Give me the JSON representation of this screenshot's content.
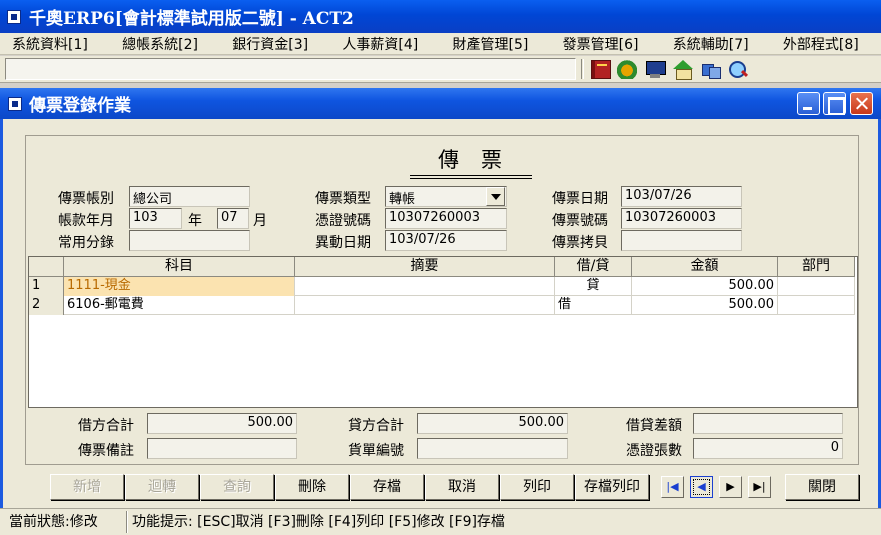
{
  "app": {
    "title": "千奧ERP6[會計標準試用版二號] - ACT2"
  },
  "menu": [
    "系統資料[1]",
    "總帳系統[2]",
    "銀行資金[3]",
    "人事薪資[4]",
    "財產管理[5]",
    "發票管理[6]",
    "系統輔助[7]",
    "外部程式[8]"
  ],
  "toolbar_icons": [
    "book-icon",
    "recycle-icon",
    "monitor-icon",
    "house-icon",
    "cubes-icon",
    "magnifier-icon"
  ],
  "window": {
    "title": "傳票登錄作業"
  },
  "voucher": {
    "heading": "傳票",
    "labels": {
      "account_book": "傳票帳別",
      "ym": "帳款年月",
      "year_unit": "年",
      "month_unit": "月",
      "common_entry": "常用分錄",
      "type": "傳票類型",
      "certificate_no": "憑證號碼",
      "change_date": "異動日期",
      "date": "傳票日期",
      "number": "傳票號碼",
      "copy": "傳票拷貝"
    },
    "values": {
      "account_book": "總公司",
      "year": "103",
      "month": "07",
      "common_entry": "",
      "type": "轉帳",
      "certificate_no": "10307260003",
      "change_date": "103/07/26",
      "date": "103/07/26",
      "number": "10307260003",
      "copy": ""
    }
  },
  "grid": {
    "columns": [
      "科目",
      "摘要",
      "借/貸",
      "金額",
      "部門"
    ],
    "rows": [
      {
        "no": "1",
        "account": "1111-現金",
        "summary": "",
        "dc": "貸",
        "amount": "500.00",
        "dept": ""
      },
      {
        "no": "2",
        "account": "6106-郵電費",
        "summary": "",
        "dc": "借",
        "amount": "500.00",
        "dept": ""
      }
    ]
  },
  "totals": {
    "labels": {
      "debit_total": "借方合計",
      "credit_total": "貸方合計",
      "difference": "借貸差額",
      "remark": "傳票備註",
      "bill_no": "貨單編號",
      "cert_count": "憑證張數"
    },
    "values": {
      "debit_total": "500.00",
      "credit_total": "500.00",
      "difference": "",
      "remark": "",
      "bill_no": "",
      "cert_count": "0"
    }
  },
  "buttons": {
    "add": "新增",
    "transfer": "迴轉",
    "query": "查詢",
    "delete": "刪除",
    "save": "存檔",
    "cancel": "取消",
    "print": "列印",
    "save_print": "存檔列印",
    "close": "關閉"
  },
  "status": {
    "state": "當前狀態:修改",
    "hint": "功能提示: [ESC]取消 [F3]刪除 [F4]列印 [F5]修改 [F9]存檔"
  }
}
